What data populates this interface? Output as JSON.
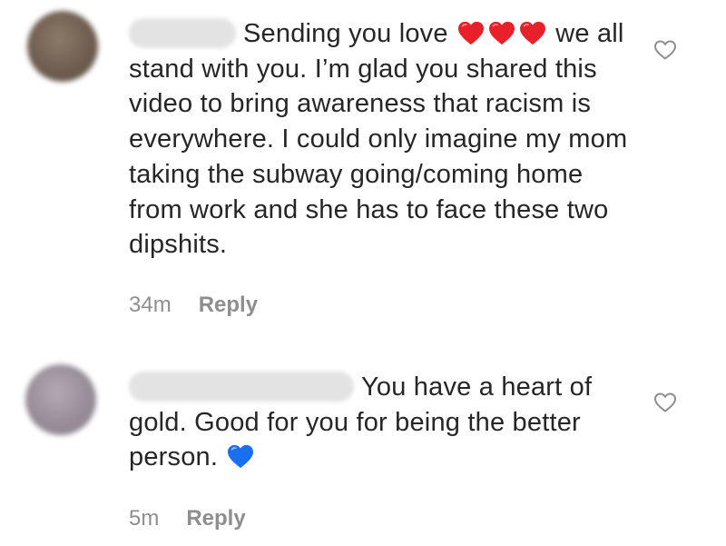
{
  "comments": [
    {
      "time": "34m",
      "reply_label": "Reply",
      "text_lead": "Sending you love",
      "text_after_hearts": "we all stand with you. I’m glad you shared this video to bring awareness that racism is everywhere. I could only imagine my mom taking the subway going/coming home from work and she has to face these two dipshits.",
      "emoji": [
        "red-heart-emoji",
        "red-heart-emoji",
        "red-heart-emoji"
      ]
    },
    {
      "time": "5m",
      "reply_label": "Reply",
      "text_lead": "You have a heart of gold. Good for you for being the better person.",
      "emoji": [
        "blue-heart-emoji"
      ]
    }
  ],
  "colors": {
    "text": "#262626",
    "meta": "#8e8e8e",
    "red_heart": "#e8202a",
    "blue_heart": "#1a6ef0",
    "like_icon": "#8e8e8e"
  }
}
